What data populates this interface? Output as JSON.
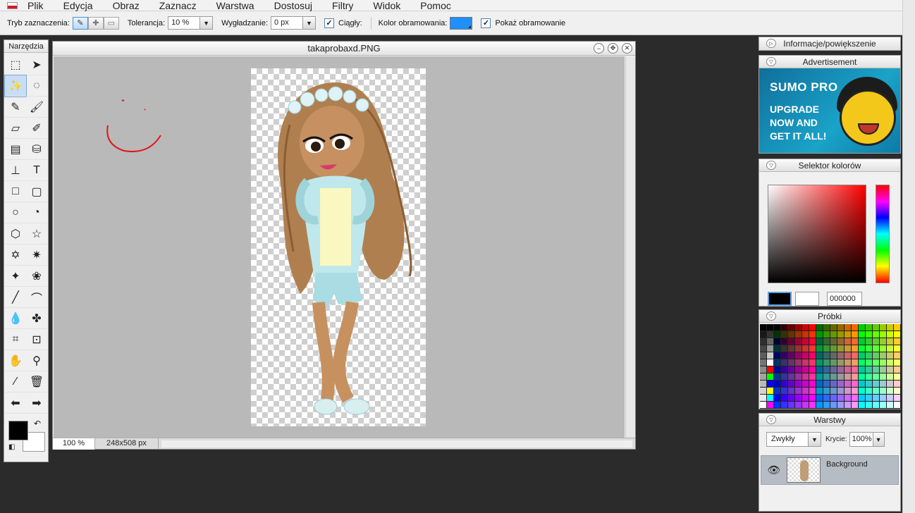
{
  "menu": {
    "items": [
      "Plik",
      "Edycja",
      "Obraz",
      "Zaznacz",
      "Warstwa",
      "Dostosuj",
      "Filtry",
      "Widok",
      "Pomoc"
    ]
  },
  "options": {
    "mode_label": "Tryb zaznaczenia:",
    "tolerance_label": "Tolerancja:",
    "tolerance_value": "10 %",
    "smoothing_label": "Wygładzanie:",
    "smoothing_value": "0 px",
    "contiguous_label": "Ciągły:",
    "border_color_label": "Kolor obramowania:",
    "border_color": "#1e90ff",
    "show_border_label": "Pokaż obramowanie"
  },
  "tools": {
    "title": "Narzędzia",
    "items": [
      {
        "name": "marquee-icon",
        "glyph": "⬚"
      },
      {
        "name": "move-icon",
        "glyph": "➤"
      },
      {
        "name": "magic-wand-icon",
        "glyph": "✨"
      },
      {
        "name": "lasso-icon",
        "glyph": "◌"
      },
      {
        "name": "pencil-icon",
        "glyph": "✎"
      },
      {
        "name": "brush-icon",
        "glyph": "🖌"
      },
      {
        "name": "eraser-icon",
        "glyph": "▱"
      },
      {
        "name": "smudge-icon",
        "glyph": "✐"
      },
      {
        "name": "gradient-icon",
        "glyph": "▤"
      },
      {
        "name": "fill-bucket-icon",
        "glyph": "⛁"
      },
      {
        "name": "clone-stamp-icon",
        "glyph": "⊥"
      },
      {
        "name": "type-icon",
        "glyph": "T"
      },
      {
        "name": "rectangle-icon",
        "glyph": "□"
      },
      {
        "name": "rounded-rect-icon",
        "glyph": "▢"
      },
      {
        "name": "ellipse-icon",
        "glyph": "○"
      },
      {
        "name": "pie-icon",
        "glyph": "◔"
      },
      {
        "name": "hexagon-icon",
        "glyph": "⬡"
      },
      {
        "name": "star-icon",
        "glyph": "☆"
      },
      {
        "name": "star-six-icon",
        "glyph": "✡"
      },
      {
        "name": "burst-icon",
        "glyph": "✷"
      },
      {
        "name": "blob-icon",
        "glyph": "✦"
      },
      {
        "name": "flower-icon",
        "glyph": "❀"
      },
      {
        "name": "line-icon",
        "glyph": "╱"
      },
      {
        "name": "curve-icon",
        "glyph": "⌒"
      },
      {
        "name": "blur-drop-icon",
        "glyph": "💧"
      },
      {
        "name": "sharpen-icon",
        "glyph": "✤"
      },
      {
        "name": "crop-icon",
        "glyph": "⌗"
      },
      {
        "name": "transform-icon",
        "glyph": "⊡"
      },
      {
        "name": "hand-icon",
        "glyph": "✋"
      },
      {
        "name": "zoom-icon",
        "glyph": "⚲"
      },
      {
        "name": "eyedropper-icon",
        "glyph": "⁄"
      },
      {
        "name": "trash-icon",
        "glyph": "🗑"
      },
      {
        "name": "undo-arrow-icon",
        "glyph": "⬅"
      },
      {
        "name": "redo-arrow-icon",
        "glyph": "➡"
      }
    ]
  },
  "image_window": {
    "title": "takaprobaxd.PNG",
    "zoom": "100 %",
    "dimensions": "248x508 px"
  },
  "panels": {
    "info_title": "Informacje/powiększenie",
    "ad_title": "Advertisement",
    "ad": {
      "headline": "SUMO PRO",
      "line1": "UPGRADE",
      "line2": "NOW AND",
      "line3": "GET IT ALL!"
    },
    "color_title": "Selektor kolorów",
    "hex_value": "000000",
    "swatches_title": "Próbki",
    "layers_title": "Warstwy",
    "blend_mode": "Zwykły",
    "opacity_label": "Krycie:",
    "opacity_value": "100%",
    "layer_name": "Background"
  }
}
